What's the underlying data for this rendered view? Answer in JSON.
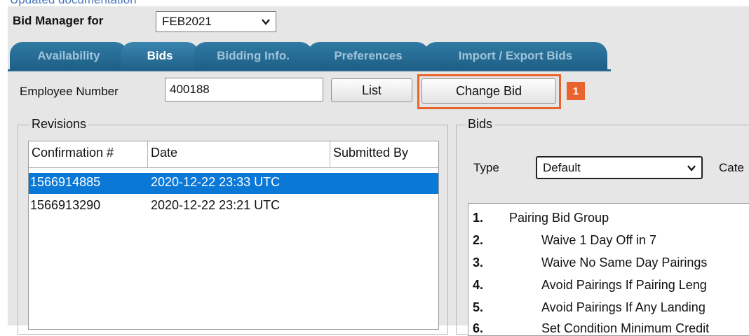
{
  "header": {
    "top_cut_text": "Updated documentation",
    "title_label": "Bid Manager for",
    "period_value": "FEB2021"
  },
  "tabs": [
    {
      "label": "Availability",
      "active": false
    },
    {
      "label": "Bids",
      "active": true
    },
    {
      "label": "Bidding Info.",
      "active": false
    },
    {
      "label": "Preferences",
      "active": false
    },
    {
      "label": "Import / Export Bids",
      "active": false
    }
  ],
  "employee": {
    "label": "Employee Number",
    "value": "400188",
    "list_button": "List",
    "change_bid_button": "Change Bid",
    "callout_number": "1"
  },
  "revisions": {
    "legend": "Revisions",
    "columns": [
      "Confirmation #",
      "Date",
      "Submitted By"
    ],
    "rows": [
      {
        "confirmation": "1566914885",
        "date": "2020-12-22 23:33 UTC",
        "submitted_by": "",
        "selected": true
      },
      {
        "confirmation": "1566913290",
        "date": "2020-12-22 23:21 UTC",
        "submitted_by": "",
        "selected": false
      }
    ]
  },
  "bids": {
    "legend": "Bids",
    "type_label": "Type",
    "type_value": "Default",
    "category_label_cut": "Cate",
    "lines": [
      {
        "num": "1.",
        "text": "Pairing Bid Group"
      },
      {
        "num": "2.",
        "text": "Waive 1 Day Off in 7"
      },
      {
        "num": "3.",
        "text": "Waive No Same Day Pairings"
      },
      {
        "num": "4.",
        "text": "Avoid Pairings If Pairing Leng"
      },
      {
        "num": "5.",
        "text": "Avoid Pairings If Any Landing"
      },
      {
        "num": "6.",
        "text": "Set Condition Minimum Credit"
      }
    ]
  },
  "colors": {
    "tab_bg": "#1e5f86",
    "selection": "#0a78d7",
    "callout": "#e8642c",
    "panel_bg": "#e6e6e6"
  }
}
